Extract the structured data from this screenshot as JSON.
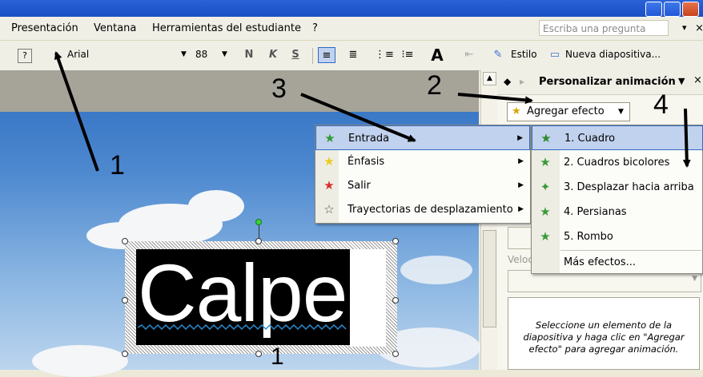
{
  "menubar": {
    "items": [
      "Presentación",
      "Ventana",
      "Herramientas del estudiante",
      "?"
    ],
    "help_placeholder": "Escriba una pregunta"
  },
  "toolbar": {
    "font_name": "Arial",
    "font_size": "88",
    "bold": "N",
    "italic": "K",
    "shadow": "S",
    "style_label": "Estilo",
    "new_slide_label": "Nueva diapositiva..."
  },
  "taskpane": {
    "title": "Personalizar animación",
    "add_effect": "Agregar efecto",
    "speed_label": "Veloc",
    "hint": "Seleccione un elemento de la diapositiva y haga clic en \"Agregar efecto\" para agregar animación."
  },
  "effect_menu": {
    "items": [
      {
        "label": "Entrada",
        "icon": "star-green-icon"
      },
      {
        "label": "Énfasis",
        "icon": "star-yellow-icon"
      },
      {
        "label": "Salir",
        "icon": "star-red-icon"
      },
      {
        "label": "Trayectorias de desplazamiento",
        "icon": "star-outline-icon"
      }
    ]
  },
  "entry_submenu": {
    "items": [
      "1. Cuadro",
      "2. Cuadros bicolores",
      "3. Desplazar hacia arriba",
      "4. Persianas",
      "5. Rombo"
    ],
    "more": "Más efectos..."
  },
  "slide": {
    "text": "Calpe",
    "below_char": "1"
  },
  "annotations": [
    "1",
    "2",
    "3",
    "4"
  ]
}
